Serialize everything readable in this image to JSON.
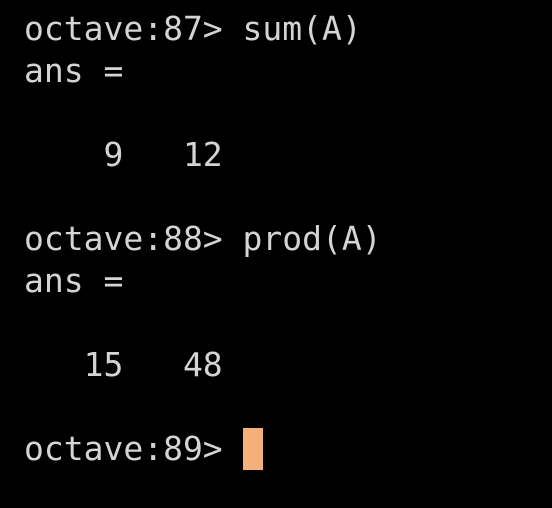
{
  "colors": {
    "background": "#000000",
    "foreground": "#d4d4d4",
    "cursor": "#f4b07a"
  },
  "terminal": {
    "lines": [
      {
        "prompt": "octave:87> ",
        "command": "sum(A)"
      },
      {
        "output": "ans ="
      },
      {
        "output": "    9   12"
      },
      {
        "prompt": "octave:88> ",
        "command": "prod(A)"
      },
      {
        "output": "ans ="
      },
      {
        "output": "   15   48"
      },
      {
        "prompt": "octave:89> ",
        "command": ""
      }
    ]
  }
}
